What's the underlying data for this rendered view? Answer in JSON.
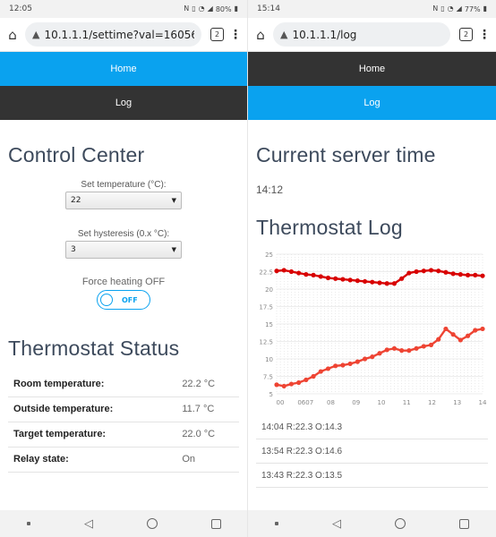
{
  "left": {
    "status_time": "12:05",
    "battery": "80%",
    "url": "10.1.1.1/settime?val=16056",
    "tab_count": "2",
    "nav": {
      "home": "Home",
      "log": "Log"
    },
    "title": "Control Center",
    "temp_label": "Set temperature (°C):",
    "temp_value": "22",
    "hyst_label": "Set hysteresis (0.x °C):",
    "hyst_value": "3",
    "force_label": "Force heating OFF",
    "toggle_text": "OFF",
    "status_title": "Thermostat Status",
    "status_rows": [
      {
        "k": "Room temperature:",
        "v": "22.2 °C"
      },
      {
        "k": "Outside temperature:",
        "v": "11.7 °C"
      },
      {
        "k": "Target temperature:",
        "v": "22.0 °C"
      },
      {
        "k": "Relay state:",
        "v": "On"
      }
    ]
  },
  "right": {
    "status_time": "15:14",
    "battery": "77%",
    "url": "10.1.1.1/log",
    "tab_count": "2",
    "nav": {
      "home": "Home",
      "log": "Log"
    },
    "time_title": "Current server time",
    "time_value": "14:12",
    "log_title": "Thermostat Log",
    "log_lines": [
      "14:04 R:22.3 O:14.3",
      "13:54 R:22.3 O:14.6",
      "13:43 R:22.3 O:13.5"
    ]
  },
  "colors": {
    "accent": "#0aa2ef",
    "nav_dark": "#333333",
    "room_series": "#d80000",
    "outside_series": "#ee4433"
  },
  "chart_data": {
    "type": "line",
    "yticks": [
      "25",
      "22.5",
      "20",
      "17.5",
      "15",
      "12.5",
      "10",
      "7.5",
      "5"
    ],
    "xticks": [
      "00",
      "0607",
      "08",
      "09",
      "10",
      "11",
      "12",
      "13",
      "14"
    ],
    "ylim": [
      5,
      25
    ],
    "xlim": [
      0,
      14
    ],
    "x": [
      0,
      0.5,
      1,
      1.5,
      2,
      2.5,
      3,
      3.5,
      4,
      4.5,
      5,
      5.5,
      6,
      6.5,
      7,
      7.5,
      8,
      8.5,
      9,
      9.5,
      10,
      10.5,
      11,
      11.5,
      12,
      12.5,
      13,
      13.5,
      14
    ],
    "series": [
      {
        "values": [
          22.6,
          22.7,
          22.5,
          22.3,
          22.1,
          22.0,
          21.8,
          21.6,
          21.5,
          21.4,
          21.3,
          21.2,
          21.1,
          21.0,
          20.9,
          20.8,
          20.8,
          21.5,
          22.3,
          22.5,
          22.6,
          22.7,
          22.6,
          22.4,
          22.2,
          22.1,
          22.0,
          22.0,
          21.9
        ]
      },
      {
        "values": [
          6.3,
          6.1,
          6.4,
          6.6,
          7.0,
          7.5,
          8.2,
          8.6,
          9.0,
          9.1,
          9.3,
          9.6,
          10.0,
          10.3,
          10.8,
          11.3,
          11.5,
          11.2,
          11.2,
          11.5,
          11.8,
          12.0,
          12.8,
          14.3,
          13.5,
          12.7,
          13.3,
          14.1,
          14.3
        ]
      }
    ]
  }
}
